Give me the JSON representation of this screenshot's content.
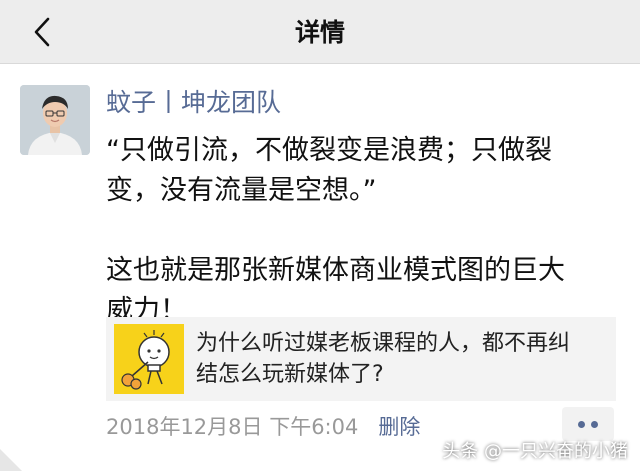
{
  "nav": {
    "title": "详情",
    "back_icon": "chevron-left-icon"
  },
  "post": {
    "author": "蚊子丨坤龙团队",
    "lines": [
      "“只做引流，不做裂变是浪费；只做裂",
      "变，没有流量是空想。”",
      "这也就是那张新媒体商业模式图的巨大",
      "威力！"
    ],
    "link_card": {
      "title_lines": [
        "为什么听过媒老板课程的人，都不再纠",
        "结怎么玩新媒体了?"
      ]
    },
    "timestamp": "2018年12月8日 下午6:04",
    "delete_label": "删除"
  },
  "watermark": {
    "text": "头条 @一只兴奋的小猪"
  },
  "colors": {
    "nav_bg": "#ededed",
    "link_blue": "#576b95",
    "meta_gray": "#999999",
    "card_bg": "#f3f3f3",
    "thumb_yellow": "#f7d21a"
  }
}
